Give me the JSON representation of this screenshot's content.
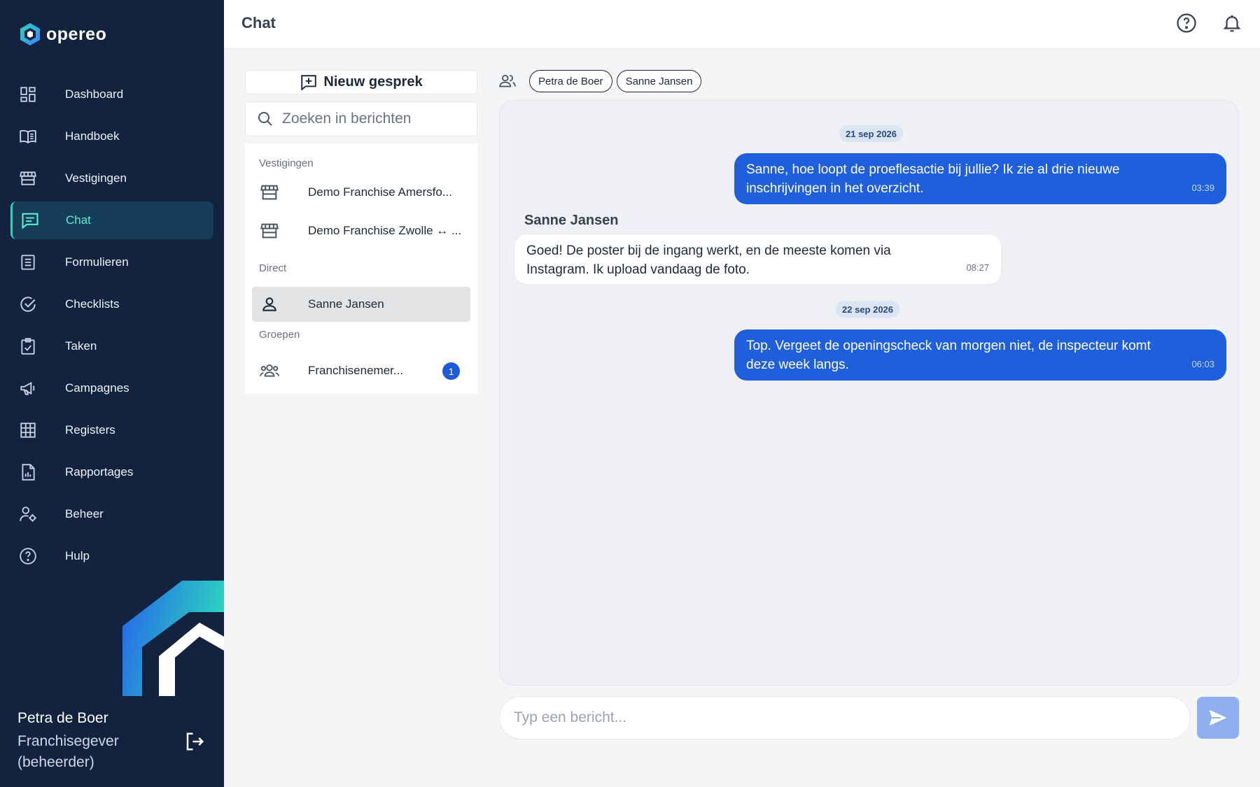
{
  "app": {
    "brand": "opereo",
    "page_title": "Chat"
  },
  "sidebar": {
    "items": [
      {
        "label": "Dashboard",
        "icon": "dashboard-icon"
      },
      {
        "label": "Handboek",
        "icon": "book-icon"
      },
      {
        "label": "Vestigingen",
        "icon": "store-icon"
      },
      {
        "label": "Chat",
        "icon": "chat-icon",
        "active": true
      },
      {
        "label": "Formulieren",
        "icon": "form-icon"
      },
      {
        "label": "Checklists",
        "icon": "check-circle-icon"
      },
      {
        "label": "Taken",
        "icon": "clipboard-check-icon"
      },
      {
        "label": "Campagnes",
        "icon": "megaphone-icon"
      },
      {
        "label": "Registers",
        "icon": "grid-icon"
      },
      {
        "label": "Rapportages",
        "icon": "report-icon"
      },
      {
        "label": "Beheer",
        "icon": "user-cog-icon"
      },
      {
        "label": "Hulp",
        "icon": "help-icon"
      }
    ],
    "user": {
      "name": "Petra de Boer",
      "role": "Franchisegever (beheerder)"
    },
    "accent_color": "#2dd4bf",
    "background_color": "#13223f"
  },
  "conversations": {
    "new_button_label": "Nieuw gesprek",
    "search_placeholder": "Zoeken in berichten",
    "sections": [
      {
        "label": "Vestigingen"
      },
      {
        "label": "Direct"
      },
      {
        "label": "Groepen"
      }
    ],
    "items": [
      {
        "name": "Demo Franchise Amersfo...",
        "icon": "store-icon"
      },
      {
        "name": "Demo Franchise Zwolle ↔ ...",
        "icon": "store-icon"
      },
      {
        "name": "Sanne Jansen",
        "icon": "person-icon",
        "selected": true
      },
      {
        "name": "Franchisenemer...",
        "icon": "group-icon",
        "unread": "1"
      }
    ]
  },
  "chat": {
    "participants": [
      "Petra de Boer",
      "Sanne Jansen"
    ],
    "dates": [
      "21 sep 2026",
      "22 sep 2026"
    ],
    "messages": [
      {
        "direction": "out",
        "text": "Sanne, hoe loopt de proeflesactie bij jullie? Ik zie al drie nieuwe inschrijvingen in het overzicht.",
        "time": "03:39"
      },
      {
        "direction": "in",
        "sender": "Sanne Jansen",
        "text": "Goed! De poster bij de ingang werkt, en de meeste komen via Instagram. Ik upload vandaag de foto.",
        "time": "08:27"
      },
      {
        "direction": "out",
        "text": "Top. Vergeet de openingscheck van morgen niet, de inspecteur komt deze week langs.",
        "time": "06:03"
      }
    ],
    "composer_placeholder": "Typ een bericht...",
    "outgoing_color": "#1f5fdc"
  }
}
